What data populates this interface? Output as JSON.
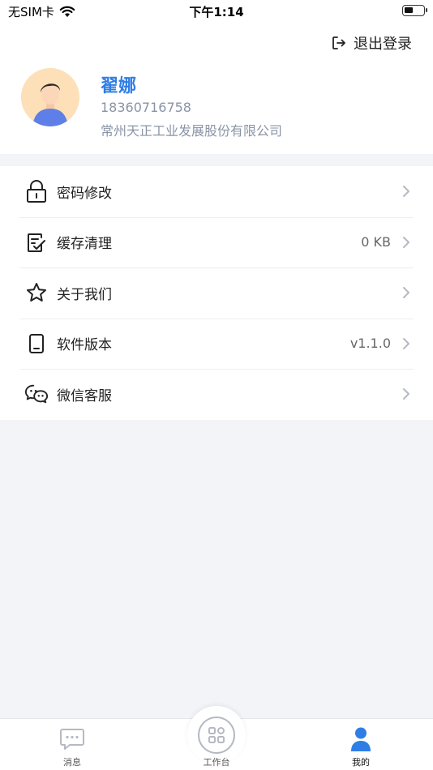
{
  "status_bar": {
    "carrier": "无SIM卡",
    "time": "下午1:14",
    "battery_level": 0.45
  },
  "header": {
    "logout_label": "退出登录",
    "user_name": "翟娜",
    "phone": "18360716758",
    "company": "常州天正工业发展股份有限公司"
  },
  "menu": {
    "items": [
      {
        "label": "密码修改",
        "value": "",
        "icon": "lock-icon"
      },
      {
        "label": "缓存清理",
        "value": "0 KB",
        "icon": "clean-cache-icon"
      },
      {
        "label": "关于我们",
        "value": "",
        "icon": "star-icon"
      },
      {
        "label": "软件版本",
        "value": "v1.1.0",
        "icon": "phone-icon"
      },
      {
        "label": "微信客服",
        "value": "",
        "icon": "wechat-icon"
      }
    ]
  },
  "tabbar": {
    "tabs": [
      {
        "label": "消息",
        "icon": "message-icon"
      },
      {
        "label": "工作台",
        "icon": "workbench-icon"
      },
      {
        "label": "我的",
        "icon": "user-icon"
      }
    ],
    "active_color": "#2f7ee6",
    "inactive_color": "#b5b9c2"
  },
  "colors": {
    "accent": "#2f7ee6",
    "muted_text": "#8a94a6",
    "background": "#f3f4f8"
  }
}
